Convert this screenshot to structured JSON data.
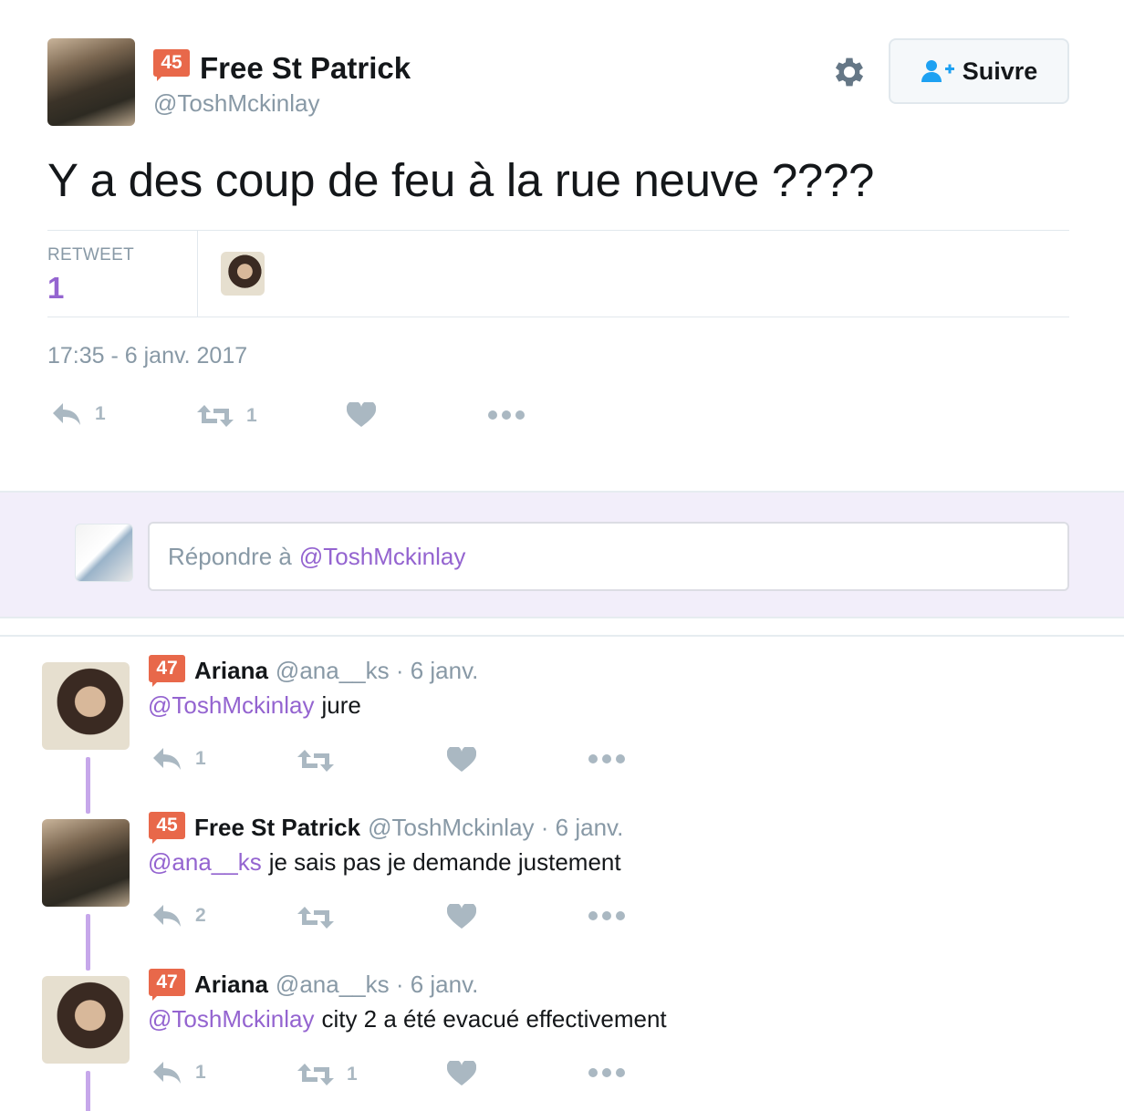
{
  "main_tweet": {
    "badge": "45",
    "name": "Free St Patrick",
    "handle": "@ToshMckinlay",
    "follow_label": "Suivre",
    "text": "Y a des coup de feu à la rue neuve ????",
    "stats_label": "RETWEET",
    "stats_count": "1",
    "timestamp": "17:35 - 6 janv. 2017",
    "actions": {
      "reply_count": "1",
      "retweet_count": "1"
    }
  },
  "reply_box": {
    "placeholder_prefix": "Répondre à",
    "placeholder_mention": "@ToshMckinlay"
  },
  "replies": [
    {
      "badge": "47",
      "name": "Ariana",
      "meta": "@ana__ks · 6 janv.",
      "mention": "@ToshMckinlay",
      "text": "jure",
      "reply_count": "1",
      "retweet_count": ""
    },
    {
      "badge": "45",
      "name": "Free St Patrick",
      "meta": "@ToshMckinlay · 6 janv.",
      "mention": "@ana__ks",
      "text": "je sais pas je demande justement",
      "reply_count": "2",
      "retweet_count": ""
    },
    {
      "badge": "47",
      "name": "Ariana",
      "meta": "@ana__ks · 6 janv.",
      "mention": "@ToshMckinlay",
      "text": "city 2 a été evacué effectivement",
      "reply_count": "1",
      "retweet_count": "1"
    }
  ],
  "colors": {
    "accent": "#9464d0",
    "badge": "#e8684a",
    "muted": "#8899a6",
    "icon": "#aab8c2",
    "thread": "#c6a7ea"
  }
}
